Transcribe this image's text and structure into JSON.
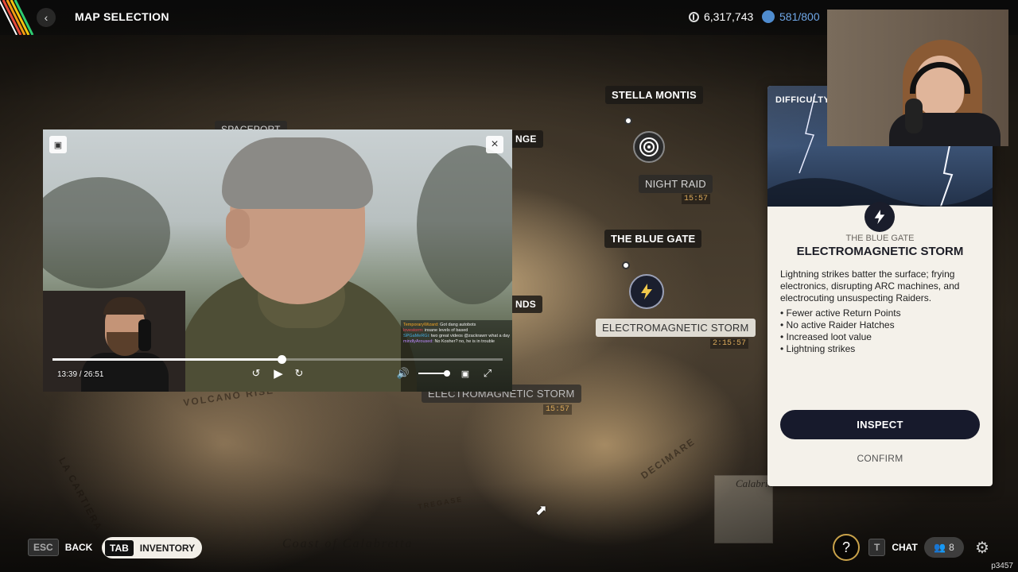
{
  "header": {
    "title": "MAP SELECTION",
    "coins": "6,317,743",
    "slots": "581/800",
    "coin_icon": "coin-icon",
    "slots_icon": "stash-icon"
  },
  "map": {
    "locations": [
      {
        "name": "STELLA MONTIS"
      },
      {
        "name": "NIGHT RAID",
        "time": "15:57"
      },
      {
        "name": "THE BLUE GATE"
      },
      {
        "name": "ELECTROMAGNETIC STORM",
        "time": "2:15:57"
      }
    ],
    "partial_labels": [
      "SPACEPORT",
      "NGE",
      "NDS",
      "ELECTROMAGNETIC STORM"
    ],
    "partial_time": "15:57",
    "terrain_text": [
      "VOLCANO RISE",
      "LA CARTIERA",
      "DECIMARE",
      "Coast of Calabretta",
      "TREGASE",
      "Calabria"
    ]
  },
  "panel": {
    "difficulty_label": "DIFFICULTY",
    "subtitle": "THE BLUE GATE",
    "title": "ELECTROMAGNETIC STORM",
    "description": "Lightning strikes batter the surface; frying electronics, disrupting ARC machines, and electrocuting unsuspecting Raiders.",
    "effects": [
      "Fewer active Return Points",
      "No active Raider Hatches",
      "Increased loot value",
      "Lightning strikes"
    ],
    "inspect_label": "INSPECT",
    "confirm_label": "CONFIRM",
    "badge_icon": "lightning-icon"
  },
  "player": {
    "time": "13:39 / 26:51",
    "progress": 0.509,
    "volume": 0.9,
    "chat": [
      {
        "user": "TemporaryWizard:",
        "msg": "Got dang autobots"
      },
      {
        "user": "lovestorm:",
        "msg": "insane levels of based"
      },
      {
        "user": "SPGaMeRGi:",
        "msg": "two great videos @zackrawrr what a day"
      },
      {
        "user": "mindlyAroused:",
        "msg": "No Kosher? no, he is in trouble"
      }
    ]
  },
  "footer": {
    "back_key": "ESC",
    "back_label": "BACK",
    "inventory_key": "TAB",
    "inventory_label": "INVENTORY",
    "help_label": "?",
    "chat_key": "T",
    "chat_label": "CHAT",
    "squad_count": "8",
    "watermark": "p3457"
  }
}
